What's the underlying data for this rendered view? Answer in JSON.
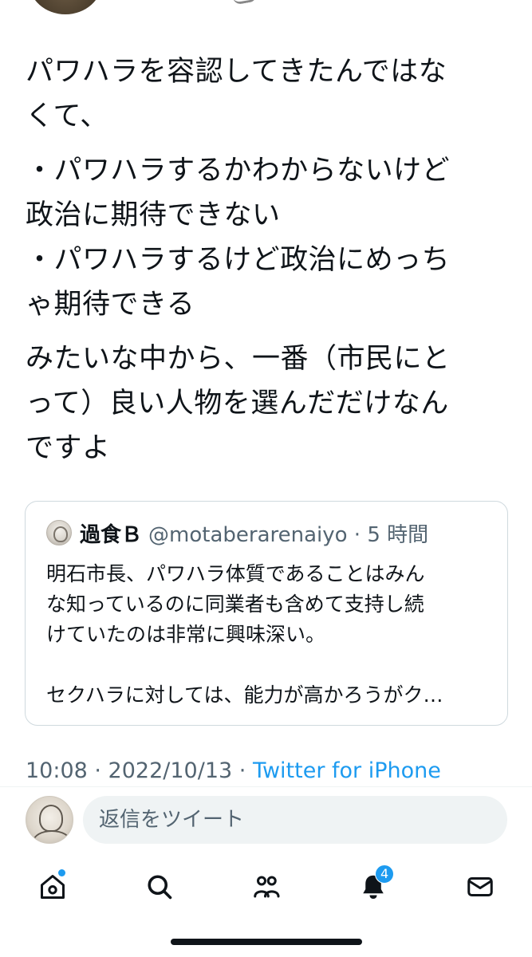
{
  "tweet": {
    "paragraphs": [
      "パワハラを容認してきたんではな\nくて、",
      "・パワハラするかわからないけど\n政治に期待できない\n・パワハラするけど政治にめっち\nゃ期待できる",
      "みたいな中から、一番（市民にと\nって）良い人物を選んだだけなん\nですよ"
    ],
    "timestamp": "10:08 · 2022/10/13 · ",
    "source": "Twitter for iPhone"
  },
  "quote": {
    "author_name": "過食Ｂ",
    "author_meta": "@motaberarenaiyo · 5 時間",
    "text": "明石市長、パワハラ体質であることはみん\nな知っているのに同業者も含めて支持し続\nけていたのは非常に興味深い。\n\nセクハラに対しては、能力が高かろうがク…"
  },
  "reply": {
    "placeholder": "返信をツイート"
  },
  "tab_bar": {
    "notifications_count": "4",
    "accent_color": "#1d9bf0",
    "icons": [
      "home-icon",
      "search-icon",
      "communities-icon",
      "notifications-icon",
      "messages-icon"
    ]
  }
}
